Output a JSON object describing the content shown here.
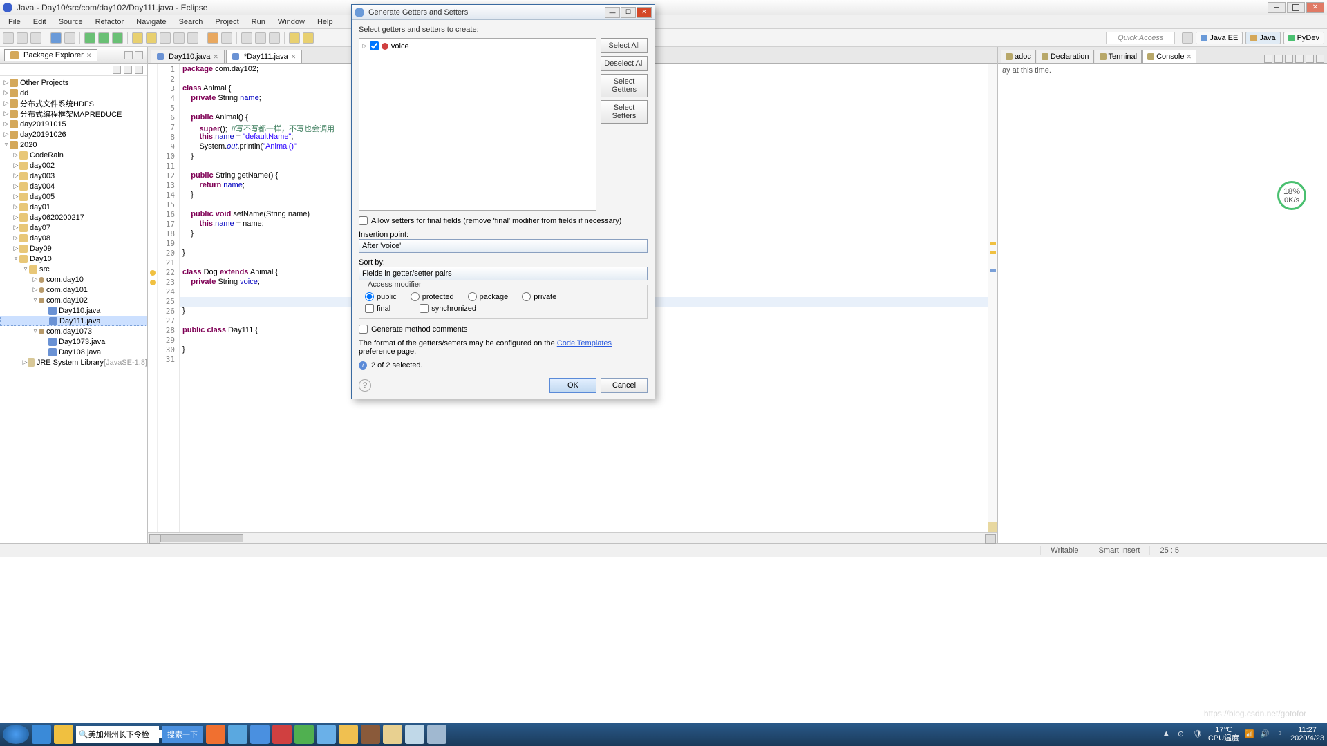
{
  "window": {
    "title": "Java - Day10/src/com/day102/Day111.java - Eclipse"
  },
  "menu": [
    "File",
    "Edit",
    "Source",
    "Refactor",
    "Navigate",
    "Search",
    "Project",
    "Run",
    "Window",
    "Help"
  ],
  "quick_access": "Quick Access",
  "perspectives": [
    "Java EE",
    "Java",
    "PyDev"
  ],
  "package_explorer": {
    "title": "Package Explorer",
    "tree": [
      {
        "d": 0,
        "tw": "▷",
        "ic": "prj",
        "label": "Other Projects"
      },
      {
        "d": 0,
        "tw": "▷",
        "ic": "prj",
        "label": "dd"
      },
      {
        "d": 0,
        "tw": "▷",
        "ic": "prj",
        "label": "分布式文件系统HDFS"
      },
      {
        "d": 0,
        "tw": "▷",
        "ic": "prj",
        "label": "分布式编程框架MAPREDUCE"
      },
      {
        "d": 0,
        "tw": "▷",
        "ic": "prj",
        "label": "day20191015"
      },
      {
        "d": 0,
        "tw": "▷",
        "ic": "prj",
        "label": "day20191026"
      },
      {
        "d": 0,
        "tw": "▿",
        "ic": "prj",
        "label": "2020"
      },
      {
        "d": 1,
        "tw": "▷",
        "ic": "fld",
        "label": "CodeRain"
      },
      {
        "d": 1,
        "tw": "▷",
        "ic": "fld",
        "label": "day002"
      },
      {
        "d": 1,
        "tw": "▷",
        "ic": "fld",
        "label": "day003"
      },
      {
        "d": 1,
        "tw": "▷",
        "ic": "fld",
        "label": "day004"
      },
      {
        "d": 1,
        "tw": "▷",
        "ic": "fld",
        "label": "day005"
      },
      {
        "d": 1,
        "tw": "▷",
        "ic": "fld",
        "label": "day01"
      },
      {
        "d": 1,
        "tw": "▷",
        "ic": "fld",
        "label": "day0620200217"
      },
      {
        "d": 1,
        "tw": "▷",
        "ic": "fld",
        "label": "day07"
      },
      {
        "d": 1,
        "tw": "▷",
        "ic": "fld",
        "label": "day08"
      },
      {
        "d": 1,
        "tw": "▷",
        "ic": "fld",
        "label": "Day09"
      },
      {
        "d": 1,
        "tw": "▿",
        "ic": "fld",
        "label": "Day10"
      },
      {
        "d": 2,
        "tw": "▿",
        "ic": "fld",
        "label": "src"
      },
      {
        "d": 3,
        "tw": "▷",
        "ic": "pkg",
        "label": "com.day10"
      },
      {
        "d": 3,
        "tw": "▷",
        "ic": "pkg",
        "label": "com.day101"
      },
      {
        "d": 3,
        "tw": "▿",
        "ic": "pkg",
        "label": "com.day102"
      },
      {
        "d": 4,
        "tw": "",
        "ic": "jf",
        "label": "Day110.java"
      },
      {
        "d": 4,
        "tw": "",
        "ic": "jf",
        "label": "Day111.java",
        "sel": true
      },
      {
        "d": 3,
        "tw": "▿",
        "ic": "pkg",
        "label": "com.day1073"
      },
      {
        "d": 4,
        "tw": "",
        "ic": "jf",
        "label": "Day1073.java"
      },
      {
        "d": 4,
        "tw": "",
        "ic": "jf",
        "label": "Day108.java"
      },
      {
        "d": 2,
        "tw": "▷",
        "ic": "lib",
        "label": "JRE System Library",
        "ver": "[JavaSE-1.8]",
        "jre": true
      }
    ]
  },
  "editor": {
    "tabs": [
      {
        "label": "Day110.java",
        "dirty": false
      },
      {
        "label": "*Day111.java",
        "dirty": true,
        "active": true
      }
    ],
    "lines": [
      {
        "n": 1,
        "html": "<span class='kw'>package</span> com.day102;"
      },
      {
        "n": 2,
        "html": ""
      },
      {
        "n": 3,
        "html": "<span class='kw'>class</span> Animal {"
      },
      {
        "n": 4,
        "html": "    <span class='kw'>private</span> String <span class='fld'>name</span>;"
      },
      {
        "n": 5,
        "html": ""
      },
      {
        "n": 6,
        "html": "    <span class='kw'>public</span> Animal() {"
      },
      {
        "n": 7,
        "html": "        <span class='kw'>super</span>();  <span class='cmt'>//写不写都一样，不写也会调用</span>"
      },
      {
        "n": 8,
        "html": "        <span class='kw'>this</span>.<span class='fld'>name</span> = <span class='str'>\"defaultName\"</span>;"
      },
      {
        "n": 9,
        "html": "        System.<span class='st'>out</span>.println(<span class='str'>\"Animal()\"</span>"
      },
      {
        "n": 10,
        "html": "    }"
      },
      {
        "n": 11,
        "html": ""
      },
      {
        "n": 12,
        "html": "    <span class='kw'>public</span> String getName() {"
      },
      {
        "n": 13,
        "html": "        <span class='kw'>return</span> <span class='fld'>name</span>;"
      },
      {
        "n": 14,
        "html": "    }"
      },
      {
        "n": 15,
        "html": ""
      },
      {
        "n": 16,
        "html": "    <span class='kw'>public</span> <span class='kw'>void</span> setName(String name)"
      },
      {
        "n": 17,
        "html": "        <span class='kw'>this</span>.<span class='fld'>name</span> = name;"
      },
      {
        "n": 18,
        "html": "    }"
      },
      {
        "n": 19,
        "html": ""
      },
      {
        "n": 20,
        "html": "}"
      },
      {
        "n": 21,
        "html": ""
      },
      {
        "n": 22,
        "html": "<span class='kw'>class</span> Dog <span class='kw'>extends</span> Animal {",
        "mk": "warn"
      },
      {
        "n": 23,
        "html": "    <span class='kw'>private</span> String <span class='fld'>voice</span>;",
        "mk": "warn"
      },
      {
        "n": 24,
        "html": ""
      },
      {
        "n": 25,
        "html": "    ",
        "current": true
      },
      {
        "n": 26,
        "html": "}"
      },
      {
        "n": 27,
        "html": ""
      },
      {
        "n": 28,
        "html": "<span class='kw'>public</span> <span class='kw'>class</span> Day111 {"
      },
      {
        "n": 29,
        "html": ""
      },
      {
        "n": 30,
        "html": "}"
      },
      {
        "n": 31,
        "html": ""
      }
    ]
  },
  "console": {
    "tabs": [
      "adoc",
      "Declaration",
      "Terminal",
      "Console"
    ],
    "active": 3,
    "message": "ay at this time."
  },
  "dialog": {
    "title": "Generate Getters and Setters",
    "header": "Select getters and setters to create:",
    "field": "voice",
    "buttons": {
      "select_all": "Select All",
      "deselect_all": "Deselect All",
      "select_getters": "Select Getters",
      "select_setters": "Select Setters"
    },
    "allow_final": "Allow setters for final fields (remove 'final' modifier from fields if necessary)",
    "insertion_label": "Insertion point:",
    "insertion_value": "After 'voice'",
    "sort_label": "Sort by:",
    "sort_value": "Fields in getter/setter pairs",
    "access_group": "Access modifier",
    "radios": {
      "public": "public",
      "protected": "protected",
      "package": "package",
      "private": "private"
    },
    "checks": {
      "final": "final",
      "synchronized": "synchronized"
    },
    "gen_comments": "Generate method comments",
    "format_pre": "The format of the getters/setters may be configured on the ",
    "format_link": "Code Templates",
    "format_post": " preference page.",
    "selection_info": "2 of 2 selected.",
    "ok": "OK",
    "cancel": "Cancel"
  },
  "status": {
    "writable": "Writable",
    "insert": "Smart Insert",
    "pos": "25 : 5"
  },
  "float": {
    "pct": "18%",
    "sub": "0K/s"
  },
  "taskbar": {
    "search_value": "美加州州长下令检",
    "search_btn": "搜索一下",
    "temp": "17℃",
    "cpu": "CPU温度",
    "time": "11:27",
    "date": "2020/4/23"
  },
  "watermark": "https://blog.csdn.net/gotofor"
}
